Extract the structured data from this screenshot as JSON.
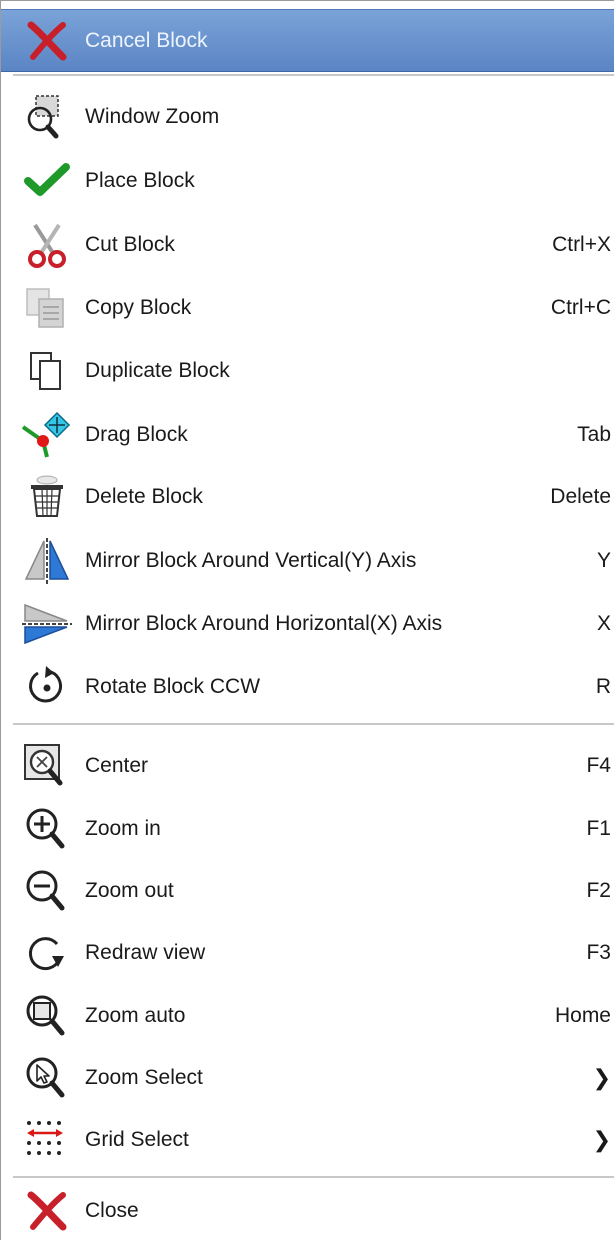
{
  "menu": {
    "cancel": {
      "label": "Cancel Block",
      "icon": "red-x-icon"
    },
    "items": [
      {
        "label": "Window Zoom",
        "shortcut": "",
        "icon": "window-zoom-icon"
      },
      {
        "label": "Place Block",
        "shortcut": "",
        "icon": "green-checkmark-icon"
      },
      {
        "label": "Cut Block",
        "shortcut": "Ctrl+X",
        "icon": "scissors-icon"
      },
      {
        "label": "Copy Block",
        "shortcut": "Ctrl+C",
        "icon": "copy-icon"
      },
      {
        "label": "Duplicate Block",
        "shortcut": "",
        "icon": "duplicate-icon"
      },
      {
        "label": "Drag Block",
        "shortcut": "Tab",
        "icon": "drag-move-icon"
      },
      {
        "label": "Delete Block",
        "shortcut": "Delete",
        "icon": "wastebasket-icon"
      },
      {
        "label": "Mirror Block Around Vertical(Y) Axis",
        "shortcut": "Y",
        "icon": "mirror-vertical-icon"
      },
      {
        "label": "Mirror Block Around Horizontal(X) Axis",
        "shortcut": "X",
        "icon": "mirror-horizontal-icon"
      },
      {
        "label": "Rotate Block CCW",
        "shortcut": "R",
        "icon": "rotate-ccw-icon"
      },
      {
        "label": "Center",
        "shortcut": "F4",
        "icon": "center-zoom-icon"
      },
      {
        "label": "Zoom in",
        "shortcut": "F1",
        "icon": "zoom-in-icon"
      },
      {
        "label": "Zoom out",
        "shortcut": "F2",
        "icon": "zoom-out-icon"
      },
      {
        "label": "Redraw view",
        "shortcut": "F3",
        "icon": "redraw-icon"
      },
      {
        "label": "Zoom auto",
        "shortcut": "Home",
        "icon": "zoom-auto-icon"
      },
      {
        "label": "Zoom Select",
        "shortcut": "❯",
        "icon": "zoom-select-icon"
      },
      {
        "label": "Grid Select",
        "shortcut": "❯",
        "icon": "grid-select-icon"
      }
    ],
    "close": {
      "label": "Close",
      "icon": "red-x-icon"
    }
  },
  "colors": {
    "highlight": "#6b95cf",
    "check_green": "#1f9a2a",
    "close_red": "#c8202a",
    "icon_dark": "#222222"
  }
}
